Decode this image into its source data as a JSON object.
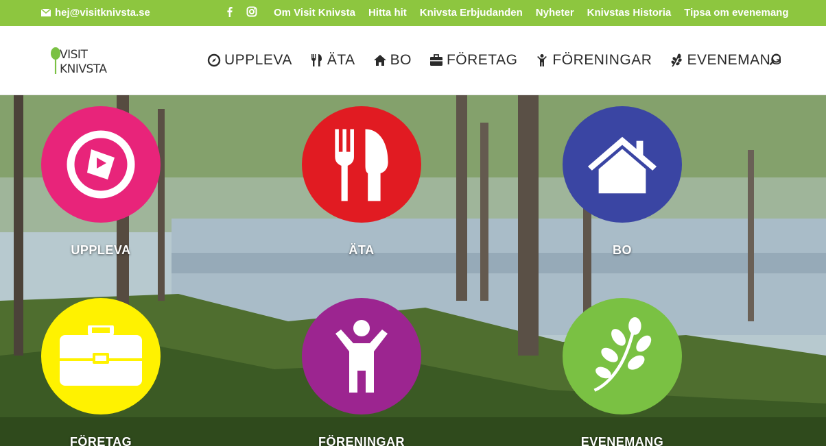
{
  "topbar": {
    "email": "hej@visitknivsta.se",
    "links": [
      "Om Visit Knivsta",
      "Hitta hit",
      "Knivsta Erbjudanden",
      "Nyheter",
      "Knivstas Historia",
      "Tipsa om evenemang"
    ],
    "bg_color": "#8dc63f"
  },
  "header": {
    "logo_text": "VISIT KNIVSTA",
    "nav": [
      {
        "label": "UPPLEVA",
        "icon": "compass-icon"
      },
      {
        "label": "ÄTA",
        "icon": "cutlery-icon"
      },
      {
        "label": "BO",
        "icon": "home-icon"
      },
      {
        "label": "FÖRETAG",
        "icon": "briefcase-icon"
      },
      {
        "label": "FÖRENINGAR",
        "icon": "person-icon"
      },
      {
        "label": "EVENEMANG",
        "icon": "leaf-icon"
      }
    ]
  },
  "tiles": [
    {
      "label": "UPPLEVA",
      "color": "#e8247a",
      "icon": "play-icon"
    },
    {
      "label": "ÄTA",
      "color": "#e11b22",
      "icon": "cutlery-icon"
    },
    {
      "label": "BO",
      "color": "#3a45a3",
      "icon": "home-icon"
    },
    {
      "label": "FÖRETAG",
      "color": "#fff200",
      "icon": "briefcase-icon"
    },
    {
      "label": "FÖRENINGAR",
      "color": "#9c2590",
      "icon": "person-icon"
    },
    {
      "label": "EVENEMANG",
      "color": "#7ac143",
      "icon": "leaf-icon"
    }
  ]
}
